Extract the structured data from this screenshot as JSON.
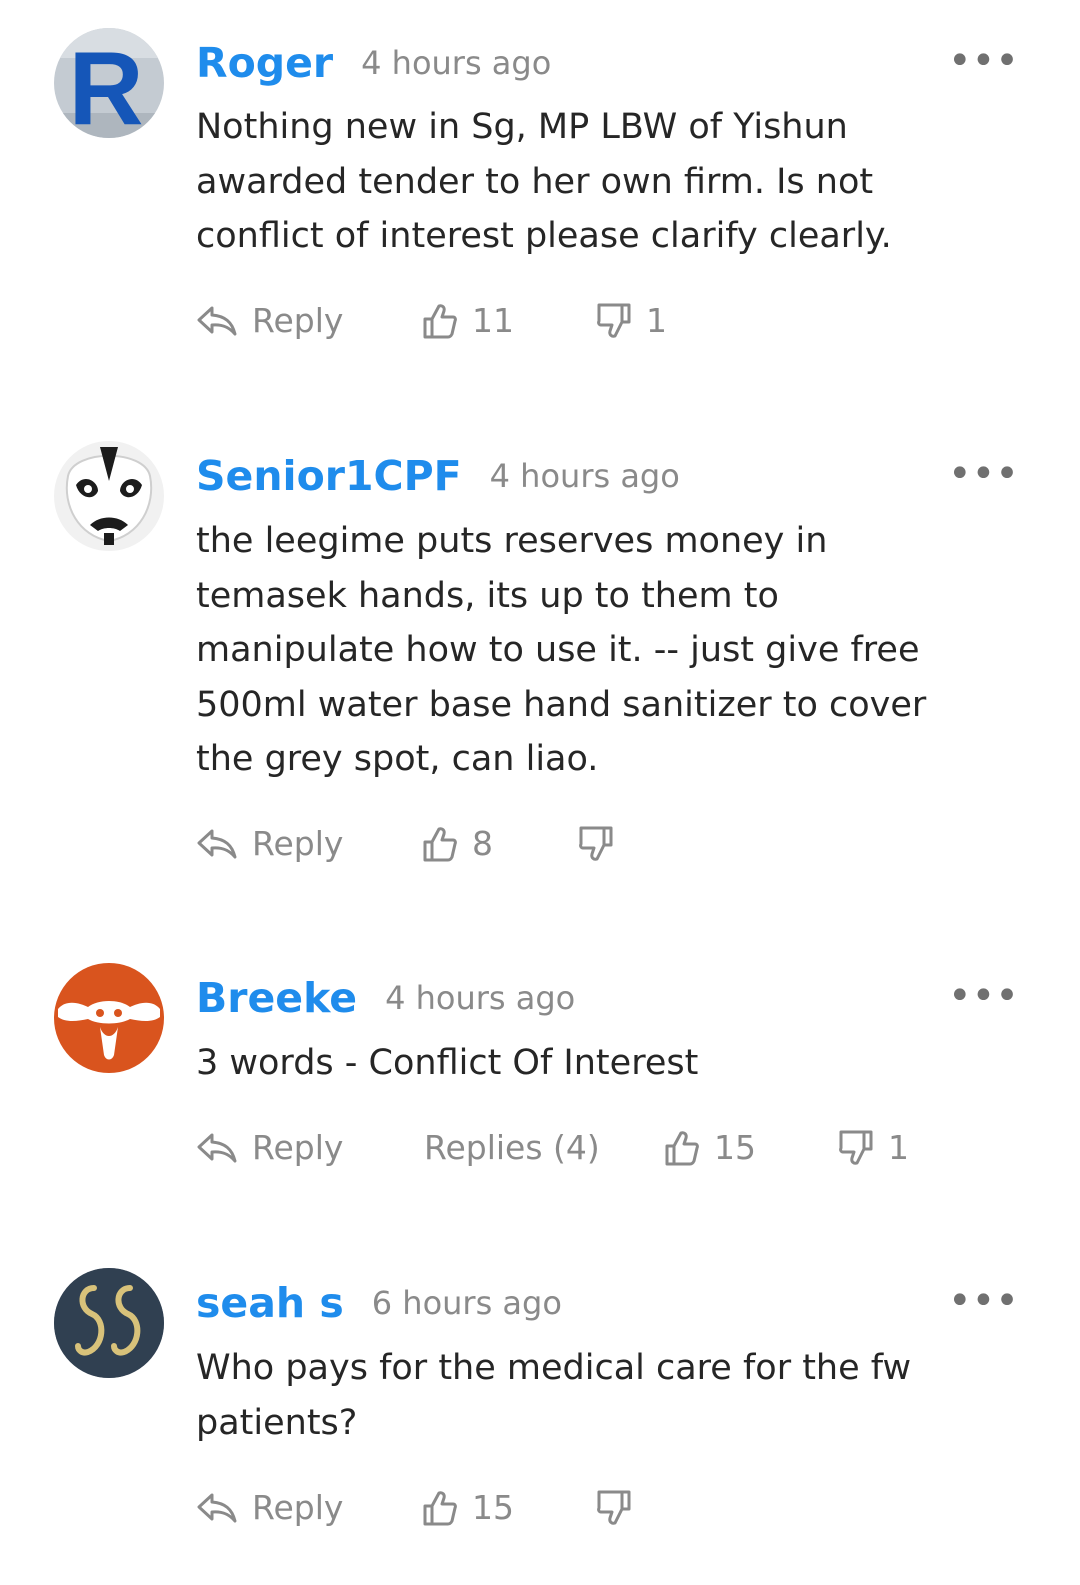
{
  "colors": {
    "username": "#1f8cec",
    "meta": "#8a8a8a",
    "text": "#262626"
  },
  "actions_text": {
    "reply_label": "Reply",
    "more_icon": "ellipsis-icon"
  },
  "comments": [
    {
      "username": "Roger",
      "time": "4 hours ago",
      "lines": [
        "Nothing new in Sg, MP LBW of Yishun",
        "awarded tender to her own firm. Is not",
        "conflict of interest please clarify clearly."
      ],
      "likes": "11",
      "dislikes": "1",
      "replies": ""
    },
    {
      "username": "Senior1CPF",
      "time": "4 hours ago",
      "lines": [
        "the leegime puts reserves money in",
        "temasek hands, its up to them to",
        "manipulate how to use it. -- just give free",
        "500ml water base hand sanitizer to cover",
        "the grey spot, can liao."
      ],
      "likes": "8",
      "dislikes": "",
      "replies": ""
    },
    {
      "username": "Breeke",
      "time": "4 hours ago",
      "lines": [
        "3 words - Conflict Of Interest"
      ],
      "likes": "15",
      "dislikes": "1",
      "replies": "Replies (4)"
    },
    {
      "username": "seah s",
      "time": "6 hours ago",
      "lines": [
        "Who pays for the medical care for the fw",
        "patients?"
      ],
      "likes": "15",
      "dislikes": "",
      "replies": ""
    }
  ]
}
